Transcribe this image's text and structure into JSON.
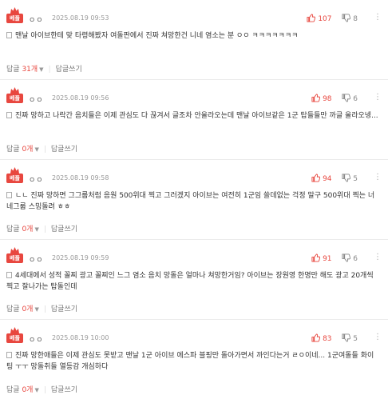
{
  "comments": [
    {
      "badge": "베플",
      "nick": "ㅇㅇ",
      "date": "2025.08.19 09:53",
      "up": "107",
      "down": "8",
      "text": "맨날 아이브한테 맞 타령해봤자 여돌판에서 진짜 쳐망한건 니네 염소는 분 ㅇㅇ ㅋㅋㅋㅋㅋㅋㅋ",
      "reply_label": "답글",
      "reply_count": "31개",
      "write_reply": "답글쓰기"
    },
    {
      "badge": "베플",
      "nick": "ㅇㅇ",
      "date": "2025.08.19 09:56",
      "up": "98",
      "down": "6",
      "text": "진짜 망하고 나락간 음치들은 이제 관심도 다 끊겨서 글조차 안올라오는데 맨날 아이브같은 1군 탑들들만 까글 올라오넹...",
      "reply_label": "답글",
      "reply_count": "0개",
      "write_reply": "답글쓰기"
    },
    {
      "badge": "베플",
      "nick": "ㅇㅇ",
      "date": "2025.08.19 09:58",
      "up": "94",
      "down": "5",
      "text": "ㄴㄴ 진짜 망하면 그그룹처럼 음원 500위대 찍고 그러겠지 아이브는 여전히 1군임 쓸데없는 걱정 말구 500위대 찍는 너네그룹 스밍돌려 ㅎㅎ",
      "reply_label": "답글",
      "reply_count": "0개",
      "write_reply": "답글쓰기"
    },
    {
      "badge": "베플",
      "nick": "ㅇㅇ",
      "date": "2025.08.19 09:59",
      "up": "91",
      "down": "6",
      "text": "4세대에서 성적 꼴찌 광고 꼴찌인 느그 염소 음치 망돌은 얼마나 쳐망한거임? 아이브는 장원영 한명만 해도 광고 20개씩 찍고 잘나가는 탑돌인데",
      "reply_label": "답글",
      "reply_count": "0개",
      "write_reply": "답글쓰기"
    },
    {
      "badge": "베플",
      "nick": "ㅇㅇ",
      "date": "2025.08.19 10:00",
      "up": "83",
      "down": "5",
      "text": "진짜 망한애들은 이제 관심도 못받고 맨날 1군 아이브 에스파 블핑만 돌아가면서 까인다는거 ㄹㅇ이네... 1군여돌들 화이팅 ㅜㅜ 망돌취들 열등감 개심하다",
      "reply_label": "답글",
      "reply_count": "0개",
      "write_reply": "답글쓰기"
    }
  ],
  "icons": {
    "badge": "crown-best-icon",
    "up": "thumbs-up-icon",
    "down": "thumbs-down-icon",
    "more": "more-vertical-icon",
    "doc": "document-icon",
    "caret": "caret-down-icon"
  },
  "colors": {
    "accent": "#e8473f",
    "muted": "#999999"
  }
}
